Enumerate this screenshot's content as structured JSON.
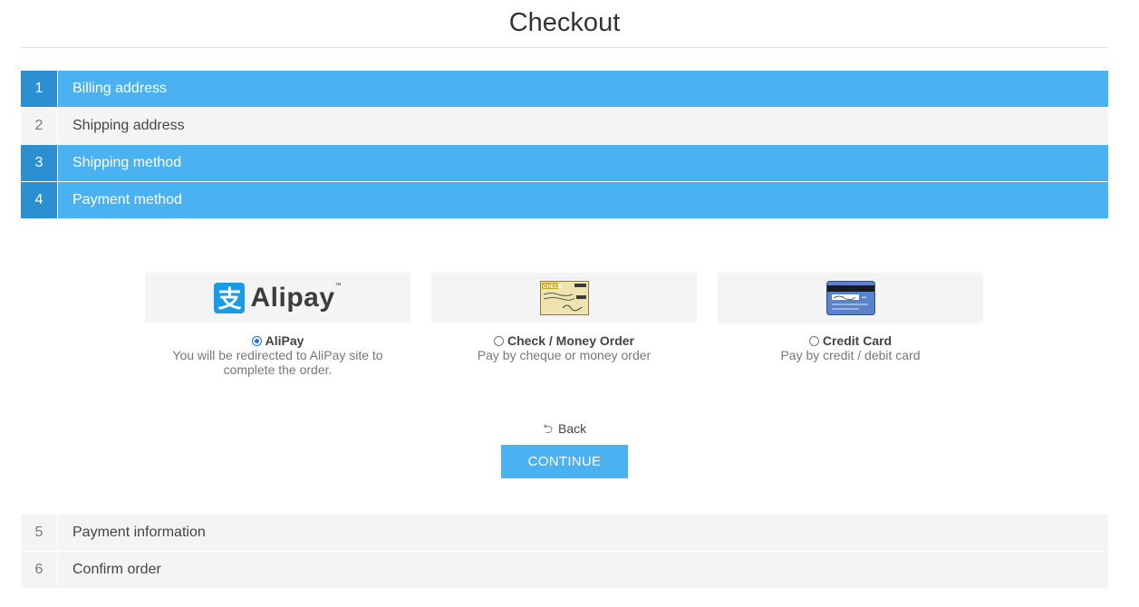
{
  "page": {
    "title": "Checkout"
  },
  "steps": [
    {
      "number": "1",
      "label": "Billing address"
    },
    {
      "number": "2",
      "label": "Shipping address"
    },
    {
      "number": "3",
      "label": "Shipping method"
    },
    {
      "number": "4",
      "label": "Payment method"
    },
    {
      "number": "5",
      "label": "Payment information"
    },
    {
      "number": "6",
      "label": "Confirm order"
    }
  ],
  "payment_methods": [
    {
      "name": "AliPay",
      "description": "You will be redirected to AliPay site to complete the order.",
      "selected": true,
      "logo_text": "Alipay",
      "logo_mark": "支",
      "icon": "alipay-logo"
    },
    {
      "name": "Check / Money Order",
      "description": "Pay by cheque or money order",
      "selected": false,
      "icon": "check-image"
    },
    {
      "name": "Credit Card",
      "description": "Pay by credit / debit card",
      "selected": false,
      "icon": "credit-card-image"
    }
  ],
  "actions": {
    "back_label": "Back",
    "continue_label": "CONTINUE"
  },
  "colors": {
    "accent": "#4ab2f1",
    "accent_dark": "#2c8fd1",
    "inactive_bg": "#f4f4f4"
  }
}
